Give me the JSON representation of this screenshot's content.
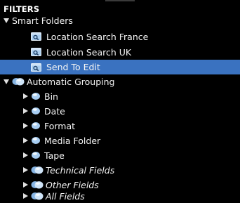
{
  "panel": {
    "title": "FILTERS",
    "smart_folders": {
      "label": "Smart Folders",
      "items": [
        {
          "label": "Location Search France",
          "icon": "smart-search-icon",
          "selected": false
        },
        {
          "label": "Location Search UK",
          "icon": "smart-search-icon",
          "selected": false
        },
        {
          "label": "Send To Edit",
          "icon": "smart-search-icon",
          "selected": true
        }
      ]
    },
    "automatic_grouping": {
      "label": "Automatic Grouping",
      "items": [
        {
          "label": "Bin",
          "icon": "group-icon",
          "italic": false
        },
        {
          "label": "Date",
          "icon": "group-icon",
          "italic": false
        },
        {
          "label": "Format",
          "icon": "group-icon",
          "italic": false
        },
        {
          "label": "Media Folder",
          "icon": "group-icon",
          "italic": false
        },
        {
          "label": "Tape",
          "icon": "group-icon",
          "italic": false
        },
        {
          "label": "Technical Fields",
          "icon": "multi-group-icon",
          "italic": true
        },
        {
          "label": "Other Fields",
          "icon": "multi-group-icon",
          "italic": true
        },
        {
          "label": "All Fields",
          "icon": "multi-group-icon",
          "italic": true
        }
      ]
    }
  },
  "colors": {
    "background": "#000000",
    "selection": "#3a72c0",
    "text": "#f4f4f4",
    "icon_blue": "#9cc6ef"
  }
}
